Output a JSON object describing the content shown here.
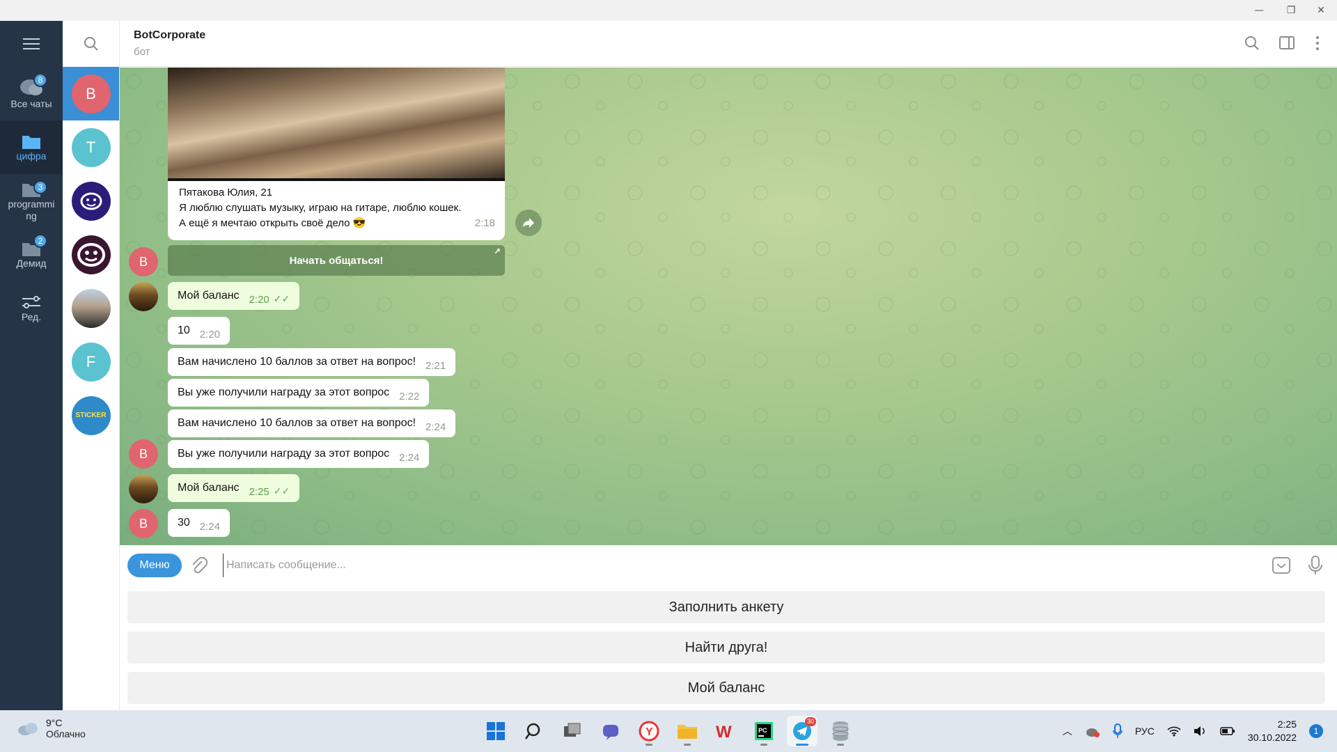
{
  "window": {
    "minimize": "—",
    "restore": "❐",
    "close": "✕"
  },
  "folders": [
    {
      "label": "Все чаты",
      "badge": "8",
      "icon": "chats-icon"
    },
    {
      "label": "цифра",
      "badge": "",
      "icon": "folder-icon",
      "active": true
    },
    {
      "label": "programmi ng",
      "badge": "3",
      "icon": "folder-icon"
    },
    {
      "label": "Демид",
      "badge": "2",
      "icon": "folder-icon"
    },
    {
      "label": "Ред.",
      "badge": "",
      "icon": "edit-icon"
    }
  ],
  "chat_list": {
    "avatars": [
      {
        "letter": "B",
        "color": "#e0656e",
        "active": true
      },
      {
        "letter": "T",
        "color": "#5ac3cf"
      },
      {
        "letter": "",
        "color": "#2a1d7a",
        "icon": "mascot-icon"
      },
      {
        "letter": "",
        "color": "#3a1530",
        "icon": "mascot-icon"
      },
      {
        "letter": "",
        "color": "#b4a08a",
        "icon": "person-photo"
      },
      {
        "letter": "F",
        "color": "#5ac3cf"
      },
      {
        "letter": "",
        "color": "#2f8ac9",
        "icon": "sticker-logo"
      }
    ],
    "sticker_text": "STICKER"
  },
  "header": {
    "title": "BotCorporate",
    "subtitle": "бот"
  },
  "messages": {
    "photo_card": {
      "line1": "Пятакова Юлия, 21",
      "line2": "Я люблю слушать музыку, играю на гитаре, люблю кошек.",
      "line3": "А ещё я мечтаю открыть своё дело 😎",
      "time": "2:18"
    },
    "inline_button": "Начать общаться!",
    "list": [
      {
        "text": "Мой баланс",
        "time": "2:20",
        "out": true
      },
      {
        "text": "10",
        "time": "2:20",
        "out": false
      },
      {
        "text": "Вам начислено 10 баллов за ответ на вопрос!",
        "time": "2:21",
        "out": false
      },
      {
        "text": "Вы уже получили награду за этот вопрос",
        "time": "2:22",
        "out": false
      },
      {
        "text": "Вам начислено 10 баллов за ответ на вопрос!",
        "time": "2:24",
        "out": false
      },
      {
        "text": "Вы уже получили награду за этот вопрос",
        "time": "2:24",
        "out": false
      },
      {
        "text": "Мой баланс",
        "time": "2:25",
        "out": true
      },
      {
        "text": "30",
        "time": "2:24",
        "out": false
      }
    ],
    "bot_avatar_letter": "B"
  },
  "input": {
    "menu_label": "Меню",
    "placeholder": "Написать сообщение..."
  },
  "keyboard": [
    "Заполнить анкету",
    "Найти друга!",
    "Мой баланс"
  ],
  "taskbar": {
    "weather_temp": "9°C",
    "weather_desc": "Облачно",
    "telegram_badge": "30",
    "lang": "РУС",
    "time": "2:25",
    "date": "30.10.2022",
    "notifications": "1"
  }
}
